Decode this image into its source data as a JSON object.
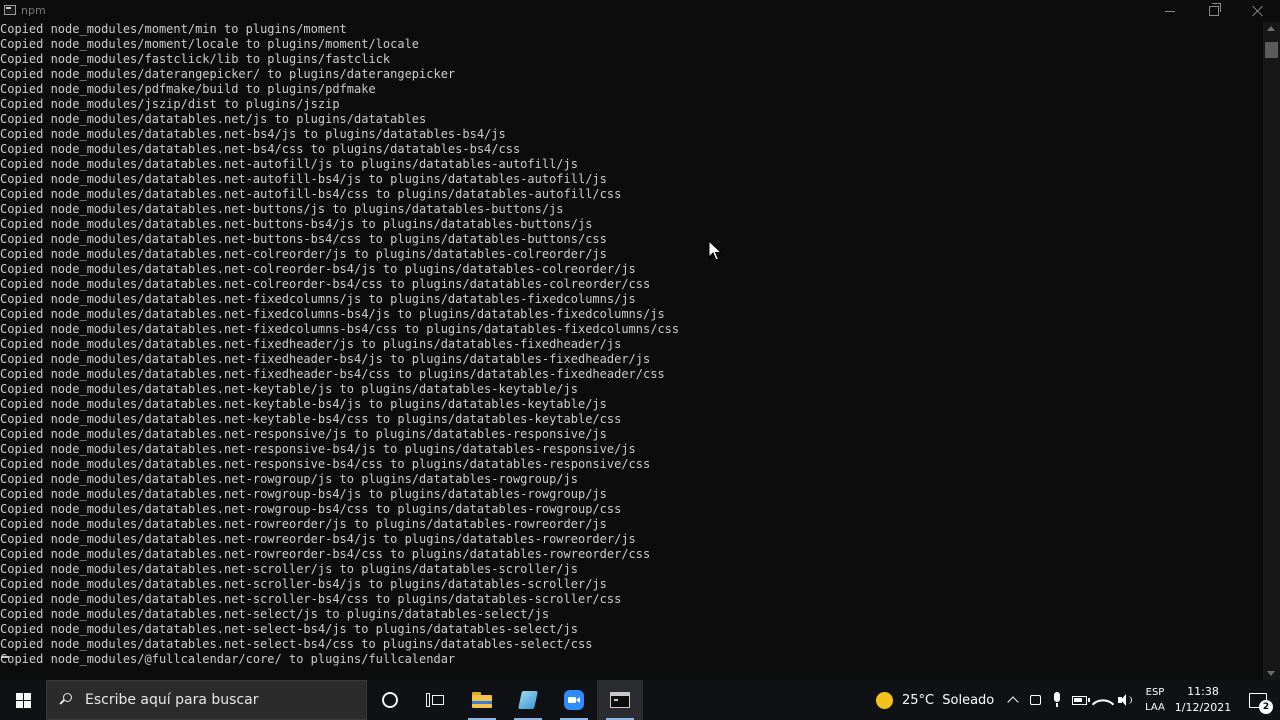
{
  "window": {
    "title": "npm"
  },
  "terminal": {
    "lines": [
      "Copied node_modules/moment/min to plugins/moment",
      "Copied node_modules/moment/locale to plugins/moment/locale",
      "Copied node_modules/fastclick/lib to plugins/fastclick",
      "Copied node_modules/daterangepicker/ to plugins/daterangepicker",
      "Copied node_modules/pdfmake/build to plugins/pdfmake",
      "Copied node_modules/jszip/dist to plugins/jszip",
      "Copied node_modules/datatables.net/js to plugins/datatables",
      "Copied node_modules/datatables.net-bs4/js to plugins/datatables-bs4/js",
      "Copied node_modules/datatables.net-bs4/css to plugins/datatables-bs4/css",
      "Copied node_modules/datatables.net-autofill/js to plugins/datatables-autofill/js",
      "Copied node_modules/datatables.net-autofill-bs4/js to plugins/datatables-autofill/js",
      "Copied node_modules/datatables.net-autofill-bs4/css to plugins/datatables-autofill/css",
      "Copied node_modules/datatables.net-buttons/js to plugins/datatables-buttons/js",
      "Copied node_modules/datatables.net-buttons-bs4/js to plugins/datatables-buttons/js",
      "Copied node_modules/datatables.net-buttons-bs4/css to plugins/datatables-buttons/css",
      "Copied node_modules/datatables.net-colreorder/js to plugins/datatables-colreorder/js",
      "Copied node_modules/datatables.net-colreorder-bs4/js to plugins/datatables-colreorder/js",
      "Copied node_modules/datatables.net-colreorder-bs4/css to plugins/datatables-colreorder/css",
      "Copied node_modules/datatables.net-fixedcolumns/js to plugins/datatables-fixedcolumns/js",
      "Copied node_modules/datatables.net-fixedcolumns-bs4/js to plugins/datatables-fixedcolumns/js",
      "Copied node_modules/datatables.net-fixedcolumns-bs4/css to plugins/datatables-fixedcolumns/css",
      "Copied node_modules/datatables.net-fixedheader/js to plugins/datatables-fixedheader/js",
      "Copied node_modules/datatables.net-fixedheader-bs4/js to plugins/datatables-fixedheader/js",
      "Copied node_modules/datatables.net-fixedheader-bs4/css to plugins/datatables-fixedheader/css",
      "Copied node_modules/datatables.net-keytable/js to plugins/datatables-keytable/js",
      "Copied node_modules/datatables.net-keytable-bs4/js to plugins/datatables-keytable/js",
      "Copied node_modules/datatables.net-keytable-bs4/css to plugins/datatables-keytable/css",
      "Copied node_modules/datatables.net-responsive/js to plugins/datatables-responsive/js",
      "Copied node_modules/datatables.net-responsive-bs4/js to plugins/datatables-responsive/js",
      "Copied node_modules/datatables.net-responsive-bs4/css to plugins/datatables-responsive/css",
      "Copied node_modules/datatables.net-rowgroup/js to plugins/datatables-rowgroup/js",
      "Copied node_modules/datatables.net-rowgroup-bs4/js to plugins/datatables-rowgroup/js",
      "Copied node_modules/datatables.net-rowgroup-bs4/css to plugins/datatables-rowgroup/css",
      "Copied node_modules/datatables.net-rowreorder/js to plugins/datatables-rowreorder/js",
      "Copied node_modules/datatables.net-rowreorder-bs4/js to plugins/datatables-rowreorder/js",
      "Copied node_modules/datatables.net-rowreorder-bs4/css to plugins/datatables-rowreorder/css",
      "Copied node_modules/datatables.net-scroller/js to plugins/datatables-scroller/js",
      "Copied node_modules/datatables.net-scroller-bs4/js to plugins/datatables-scroller/js",
      "Copied node_modules/datatables.net-scroller-bs4/css to plugins/datatables-scroller/css",
      "Copied node_modules/datatables.net-select/js to plugins/datatables-select/js",
      "Copied node_modules/datatables.net-select-bs4/js to plugins/datatables-select/js",
      "Copied node_modules/datatables.net-select-bs4/css to plugins/datatables-select/css",
      "Copied node_modules/@fullcalendar/core/ to plugins/fullcalendar"
    ]
  },
  "taskbar": {
    "search_placeholder": "Escribe aquí para buscar",
    "apps": [
      {
        "name": "cortana",
        "icon": "cortana-icon"
      },
      {
        "name": "task-view",
        "icon": "task-view-icon"
      },
      {
        "name": "file-explorer",
        "icon": "folder-icon"
      },
      {
        "name": "notes",
        "icon": "notes-icon"
      },
      {
        "name": "zoom",
        "icon": "zoom-icon"
      },
      {
        "name": "command-prompt",
        "icon": "cmd-icon",
        "active": true
      }
    ],
    "weather": {
      "temperature": "25°C",
      "condition": "Soleado"
    },
    "language": {
      "primary": "ESP",
      "secondary": "LAA"
    },
    "clock": {
      "time": "11:38",
      "date": "1/12/2021"
    },
    "notifications": {
      "count": "2"
    }
  },
  "colors": {
    "terminal_background": "#0c0c0c",
    "terminal_text": "#cccccc",
    "taskbar_background": "#101114",
    "active_indicator": "#8fb8e6"
  }
}
